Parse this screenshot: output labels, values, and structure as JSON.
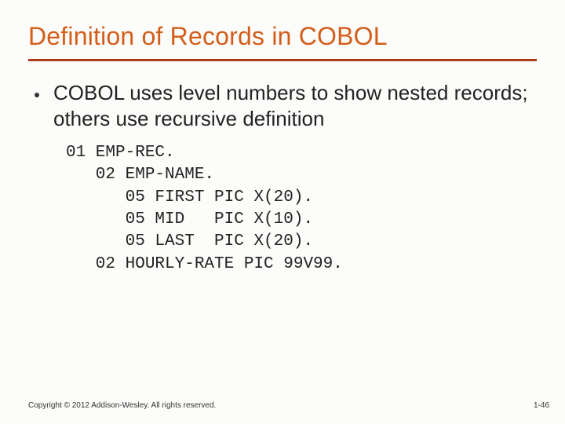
{
  "title": "Definition of Records in COBOL",
  "bullet": "COBOL uses level numbers to show nested records; others use recursive definition",
  "code": "01 EMP-REC.\n   02 EMP-NAME.\n      05 FIRST PIC X(20).\n      05 MID   PIC X(10).\n      05 LAST  PIC X(20).\n   02 HOURLY-RATE PIC 99V99.",
  "copyright": "Copyright © 2012 Addison-Wesley. All rights reserved.",
  "page": "1-46"
}
